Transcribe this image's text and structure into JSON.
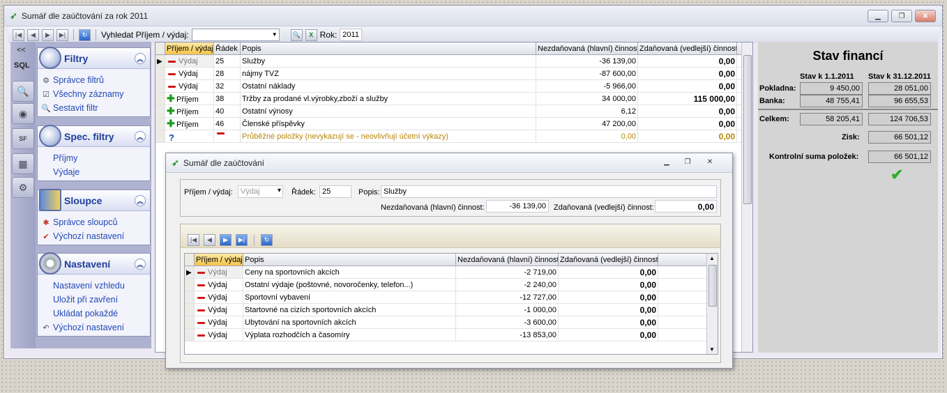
{
  "window": {
    "title": "Sumář dle zaúčtování za rok 2011"
  },
  "toolbar": {
    "search_label": "Vyhledat Příjem / výdaj:",
    "search_value": "",
    "year_label": "Rok:",
    "year_value": "2011"
  },
  "rail": {
    "collapse": "<<",
    "sql": "SQL"
  },
  "panel": {
    "filters": {
      "title": "Filtry",
      "items": [
        "Správce filtrů",
        "Všechny záznamy",
        "Sestavit filtr"
      ]
    },
    "spec": {
      "title": "Spec. filtry",
      "items": [
        "Příjmy",
        "Výdaje"
      ]
    },
    "columns": {
      "title": "Sloupce",
      "items": [
        "Správce sloupců",
        "Výchozí nastavení"
      ]
    },
    "settings": {
      "title": "Nastavení",
      "items": [
        "Nastavení vzhledu",
        "Uložit při zavření",
        "Ukládat pokaždé",
        "Výchozí nastavení"
      ]
    }
  },
  "grid": {
    "headers": [
      "Příjem / výdaj",
      "Řádek",
      "Popis",
      "Nezdaňovaná (hlavní) činnost",
      "Zdaňovaná (vedlejší) činnost"
    ],
    "rows": [
      {
        "type": "Výdaj",
        "row": "25",
        "desc": "Služby",
        "main": "-36 139,00",
        "side": "0,00"
      },
      {
        "type": "Výdaj",
        "row": "28",
        "desc": "nájmy TVZ",
        "main": "-87 600,00",
        "side": "0,00"
      },
      {
        "type": "Výdaj",
        "row": "32",
        "desc": "Ostatní náklady",
        "main": "-5 966,00",
        "side": "0,00"
      },
      {
        "type": "Příjem",
        "row": "38",
        "desc": "Tržby za prodané vl.výrobky,zboží a služby",
        "main": "34 000,00",
        "side": "115 000,00"
      },
      {
        "type": "Příjem",
        "row": "40",
        "desc": "Ostatní výnosy",
        "main": "6,12",
        "side": "0,00"
      },
      {
        "type": "Příjem",
        "row": "46",
        "desc": "Členské příspěvky",
        "main": "47 200,00",
        "side": "0,00"
      },
      {
        "type": "?",
        "row": "",
        "desc": "Průběžné položky (nevykazují se - neovlivňují účetní výkazy)",
        "main": "0,00",
        "side": "0,00"
      }
    ]
  },
  "finance": {
    "title": "Stav financí",
    "col1": "Stav k 1.1.2011",
    "col2": "Stav k 31.12.2011",
    "pokladna": {
      "label": "Pokladna:",
      "a": "9 450,00",
      "b": "28 051,00"
    },
    "banka": {
      "label": "Banka:",
      "a": "48 755,41",
      "b": "96 655,53"
    },
    "celkem": {
      "label": "Celkem:",
      "a": "58 205,41",
      "b": "124 706,53"
    },
    "zisk": {
      "label": "Zisk:",
      "v": "66 501,12"
    },
    "kontrol": {
      "label": "Kontrolní suma položek:",
      "v": "66 501,12"
    }
  },
  "dialog": {
    "title": "Sumář dle zaúčtování",
    "type_label": "Příjem / výdaj:",
    "type_value": "Výdaj",
    "row_label": "Řádek:",
    "row_value": "25",
    "desc_label": "Popis:",
    "desc_value": "Služby",
    "main_label": "Nezdaňovaná (hlavní) činnost:",
    "main_value": "-36 139,00",
    "side_label": "Zdaňovaná (vedlejší) činnost:",
    "side_value": "0,00",
    "headers": [
      "Příjem / výdaj",
      "Popis",
      "Nezdaňovaná (hlavní) činnost",
      "Zdaňovaná (vedlejší) činnost"
    ],
    "rows": [
      {
        "type": "Výdaj",
        "desc": "Ceny na sportovních akcích",
        "main": "-2 719,00",
        "side": "0,00"
      },
      {
        "type": "Výdaj",
        "desc": "Ostatní výdaje (poštovné, novoročenky, telefon...)",
        "main": "-2 240,00",
        "side": "0,00"
      },
      {
        "type": "Výdaj",
        "desc": "Sportovní vybavení",
        "main": "-12 727,00",
        "side": "0,00"
      },
      {
        "type": "Výdaj",
        "desc": "Startovné na cizích sportovních akcích",
        "main": "-1 000,00",
        "side": "0,00"
      },
      {
        "type": "Výdaj",
        "desc": "Ubytování na sportovních akcích",
        "main": "-3 600,00",
        "side": "0,00"
      },
      {
        "type": "Výdaj",
        "desc": "Výplata rozhodčích a časomíry",
        "main": "-13 853,00",
        "side": "0,00"
      }
    ]
  }
}
